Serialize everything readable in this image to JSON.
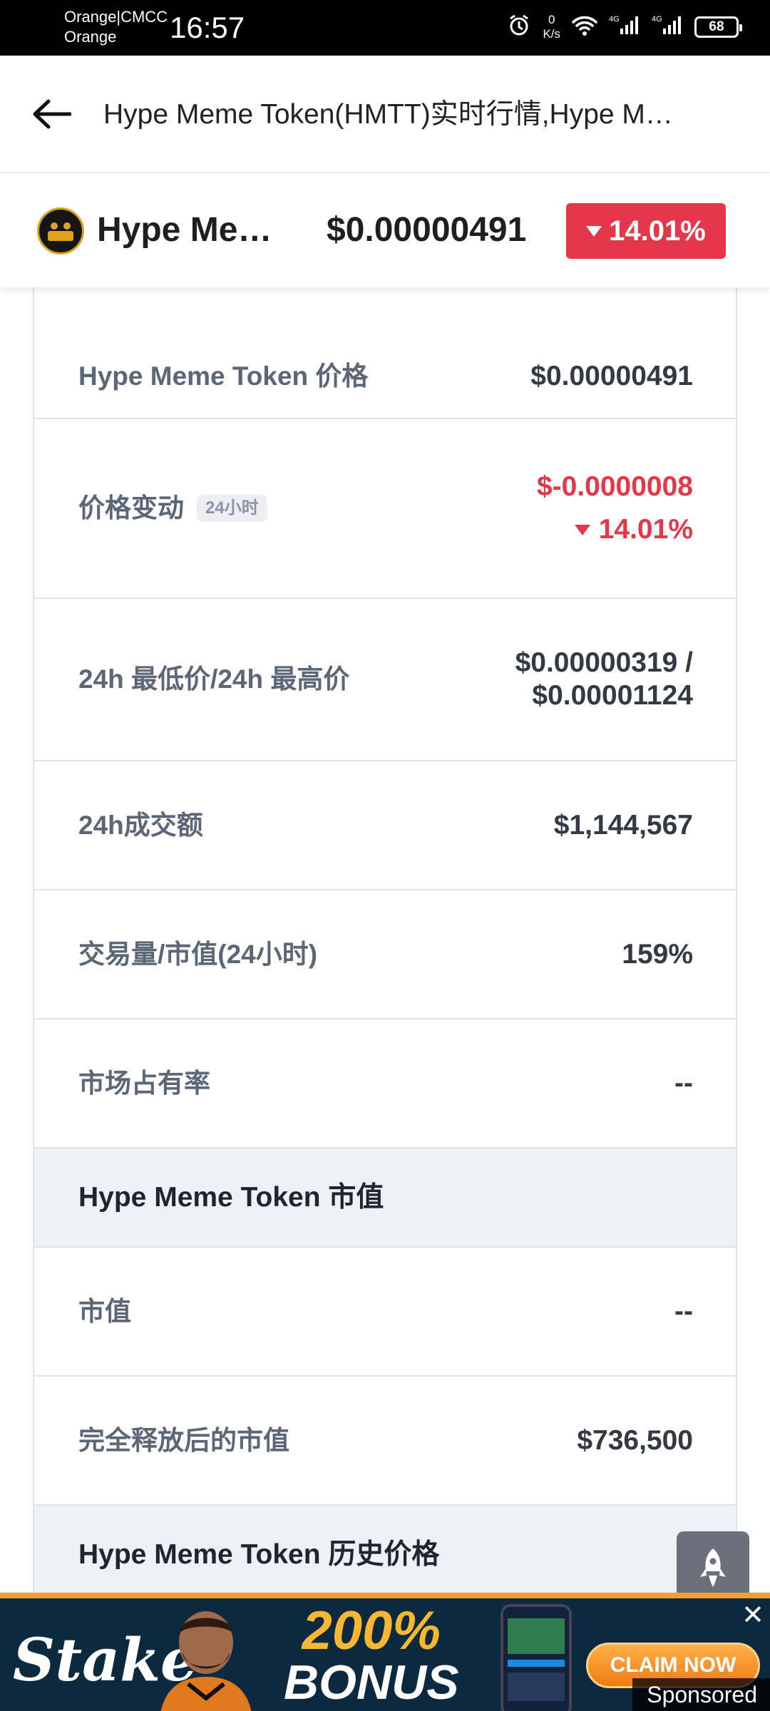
{
  "status_bar": {
    "carrier_line1": "Orange|CMCC",
    "carrier_line2": "Orange",
    "time": "16:57",
    "net_speed_value": "0",
    "net_speed_unit": "K/s",
    "signal1": "4G",
    "signal2": "4G",
    "battery": "68"
  },
  "header": {
    "title": "Hype Meme Token(HMTT)实时行情,Hype Meme Token价格"
  },
  "coin_bar": {
    "name": "Hype Meme Token",
    "price": "$0.00000491",
    "change": "14.01%",
    "colors": {
      "down": "#e5364a"
    }
  },
  "stats": {
    "price_label": "Hype Meme Token 价格",
    "price_value": "$0.00000491",
    "change_label": "价格变动",
    "change_tag": "24小时",
    "change_value": "$-0.0000008",
    "change_pct": "14.01%",
    "range_label": "24h 最低价/24h 最高价",
    "range_low": "$0.00000319 /",
    "range_high": "$0.00001124",
    "volume_label": "24h成交额",
    "volume_value": "$1,144,567",
    "vol_mcap_label": "交易量/市值(24小时)",
    "vol_mcap_value": "159%",
    "dominance_label": "市场占有率",
    "dominance_value": "--",
    "mcap_section": "Hype Meme Token 市值",
    "mcap_label": "市值",
    "mcap_value": "--",
    "fdv_label": "完全释放后的市值",
    "fdv_value": "$736,500",
    "history_section": "Hype Meme Token 历史价格"
  },
  "ad": {
    "brand": "Stake",
    "bonus_pct": "200%",
    "bonus_word": "BONUS",
    "cta": "CLAIM NOW",
    "sponsored": "Sponsored",
    "close": "✕"
  }
}
